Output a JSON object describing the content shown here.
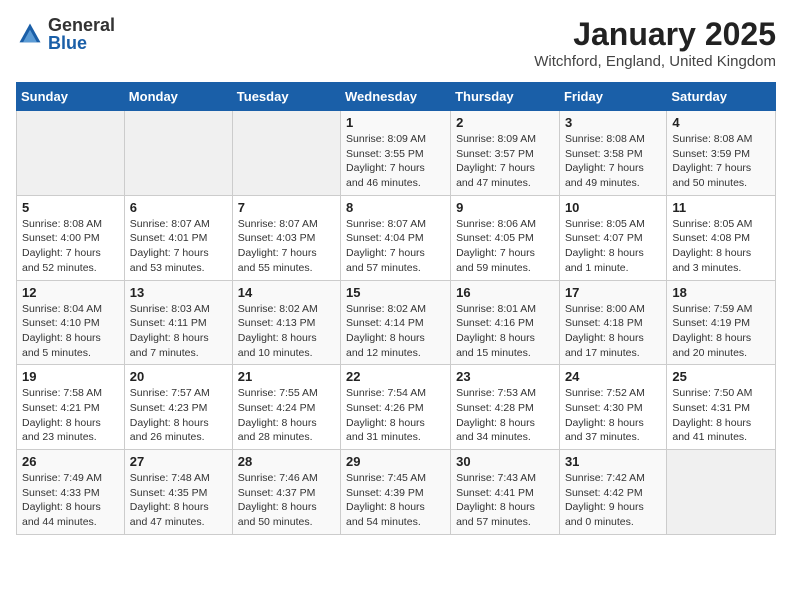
{
  "logo": {
    "general": "General",
    "blue": "Blue"
  },
  "title": "January 2025",
  "subtitle": "Witchford, England, United Kingdom",
  "days_of_week": [
    "Sunday",
    "Monday",
    "Tuesday",
    "Wednesday",
    "Thursday",
    "Friday",
    "Saturday"
  ],
  "weeks": [
    [
      {
        "day": "",
        "info": ""
      },
      {
        "day": "",
        "info": ""
      },
      {
        "day": "",
        "info": ""
      },
      {
        "day": "1",
        "info": "Sunrise: 8:09 AM\nSunset: 3:55 PM\nDaylight: 7 hours and 46 minutes."
      },
      {
        "day": "2",
        "info": "Sunrise: 8:09 AM\nSunset: 3:57 PM\nDaylight: 7 hours and 47 minutes."
      },
      {
        "day": "3",
        "info": "Sunrise: 8:08 AM\nSunset: 3:58 PM\nDaylight: 7 hours and 49 minutes."
      },
      {
        "day": "4",
        "info": "Sunrise: 8:08 AM\nSunset: 3:59 PM\nDaylight: 7 hours and 50 minutes."
      }
    ],
    [
      {
        "day": "5",
        "info": "Sunrise: 8:08 AM\nSunset: 4:00 PM\nDaylight: 7 hours and 52 minutes."
      },
      {
        "day": "6",
        "info": "Sunrise: 8:07 AM\nSunset: 4:01 PM\nDaylight: 7 hours and 53 minutes."
      },
      {
        "day": "7",
        "info": "Sunrise: 8:07 AM\nSunset: 4:03 PM\nDaylight: 7 hours and 55 minutes."
      },
      {
        "day": "8",
        "info": "Sunrise: 8:07 AM\nSunset: 4:04 PM\nDaylight: 7 hours and 57 minutes."
      },
      {
        "day": "9",
        "info": "Sunrise: 8:06 AM\nSunset: 4:05 PM\nDaylight: 7 hours and 59 minutes."
      },
      {
        "day": "10",
        "info": "Sunrise: 8:05 AM\nSunset: 4:07 PM\nDaylight: 8 hours and 1 minute."
      },
      {
        "day": "11",
        "info": "Sunrise: 8:05 AM\nSunset: 4:08 PM\nDaylight: 8 hours and 3 minutes."
      }
    ],
    [
      {
        "day": "12",
        "info": "Sunrise: 8:04 AM\nSunset: 4:10 PM\nDaylight: 8 hours and 5 minutes."
      },
      {
        "day": "13",
        "info": "Sunrise: 8:03 AM\nSunset: 4:11 PM\nDaylight: 8 hours and 7 minutes."
      },
      {
        "day": "14",
        "info": "Sunrise: 8:02 AM\nSunset: 4:13 PM\nDaylight: 8 hours and 10 minutes."
      },
      {
        "day": "15",
        "info": "Sunrise: 8:02 AM\nSunset: 4:14 PM\nDaylight: 8 hours and 12 minutes."
      },
      {
        "day": "16",
        "info": "Sunrise: 8:01 AM\nSunset: 4:16 PM\nDaylight: 8 hours and 15 minutes."
      },
      {
        "day": "17",
        "info": "Sunrise: 8:00 AM\nSunset: 4:18 PM\nDaylight: 8 hours and 17 minutes."
      },
      {
        "day": "18",
        "info": "Sunrise: 7:59 AM\nSunset: 4:19 PM\nDaylight: 8 hours and 20 minutes."
      }
    ],
    [
      {
        "day": "19",
        "info": "Sunrise: 7:58 AM\nSunset: 4:21 PM\nDaylight: 8 hours and 23 minutes."
      },
      {
        "day": "20",
        "info": "Sunrise: 7:57 AM\nSunset: 4:23 PM\nDaylight: 8 hours and 26 minutes."
      },
      {
        "day": "21",
        "info": "Sunrise: 7:55 AM\nSunset: 4:24 PM\nDaylight: 8 hours and 28 minutes."
      },
      {
        "day": "22",
        "info": "Sunrise: 7:54 AM\nSunset: 4:26 PM\nDaylight: 8 hours and 31 minutes."
      },
      {
        "day": "23",
        "info": "Sunrise: 7:53 AM\nSunset: 4:28 PM\nDaylight: 8 hours and 34 minutes."
      },
      {
        "day": "24",
        "info": "Sunrise: 7:52 AM\nSunset: 4:30 PM\nDaylight: 8 hours and 37 minutes."
      },
      {
        "day": "25",
        "info": "Sunrise: 7:50 AM\nSunset: 4:31 PM\nDaylight: 8 hours and 41 minutes."
      }
    ],
    [
      {
        "day": "26",
        "info": "Sunrise: 7:49 AM\nSunset: 4:33 PM\nDaylight: 8 hours and 44 minutes."
      },
      {
        "day": "27",
        "info": "Sunrise: 7:48 AM\nSunset: 4:35 PM\nDaylight: 8 hours and 47 minutes."
      },
      {
        "day": "28",
        "info": "Sunrise: 7:46 AM\nSunset: 4:37 PM\nDaylight: 8 hours and 50 minutes."
      },
      {
        "day": "29",
        "info": "Sunrise: 7:45 AM\nSunset: 4:39 PM\nDaylight: 8 hours and 54 minutes."
      },
      {
        "day": "30",
        "info": "Sunrise: 7:43 AM\nSunset: 4:41 PM\nDaylight: 8 hours and 57 minutes."
      },
      {
        "day": "31",
        "info": "Sunrise: 7:42 AM\nSunset: 4:42 PM\nDaylight: 9 hours and 0 minutes."
      },
      {
        "day": "",
        "info": ""
      }
    ]
  ]
}
